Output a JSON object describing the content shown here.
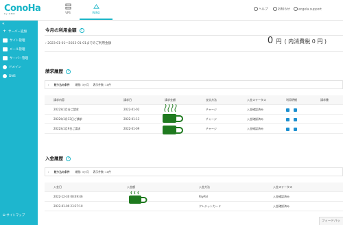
{
  "header": {
    "logo": "ConoHa",
    "logo_sub": "by GMO",
    "tabs": [
      {
        "label": "VPS"
      },
      {
        "label": "WING"
      }
    ],
    "help": "ヘルプ",
    "notice": "お知らせ",
    "account": "angela.support"
  },
  "sidebar": {
    "collapse": "«",
    "items": [
      {
        "label": "サーバー追加"
      },
      {
        "label": "サイト管理"
      },
      {
        "label": "メール管理"
      },
      {
        "label": "サーバー管理"
      },
      {
        "label": "ドメイン"
      },
      {
        "label": "DNS"
      }
    ],
    "sitemap": "サイトマップ"
  },
  "usage": {
    "title": "今月の利用金額",
    "period": "2023-01-01～2023-01-01までのご利用金額",
    "amount": "0",
    "unit": "円",
    "tax": "( 内消費税 0 円 )"
  },
  "billing": {
    "title": "請求履歴",
    "filter_label": "絞り込み条件",
    "filter_period": "期間: 3ヶ月",
    "filter_count": "表示件数: 10件",
    "columns": [
      "請求内容",
      "請求日",
      "請求金額",
      "支払方法",
      "入金ステータス",
      "利用明細",
      "請求書"
    ],
    "rows": [
      {
        "desc": "2022年1月分ご請求",
        "date": "2022-01-02",
        "method": "チャージ",
        "status": "入金確認済み"
      },
      {
        "desc": "2022年1月13日ご請求",
        "date": "2022-01-13",
        "method": "チャージ",
        "status": "入金確認済み"
      },
      {
        "desc": "2022年1月9日ご請求",
        "date": "2022-01-09",
        "method": "チャージ",
        "status": "入金確認済み"
      }
    ]
  },
  "payments": {
    "title": "入金履歴",
    "filter_label": "絞り込み条件",
    "filter_period": "期間: 3ヶ月",
    "filter_count": "表示件数: 10件",
    "columns": [
      "入金日",
      "入金額",
      "入金方法",
      "入金ステータス"
    ],
    "rows": [
      {
        "date": "2022-12-30 08:49:46",
        "method": "PayPal",
        "status": "入金確認済み"
      },
      {
        "date": "2022-01-09 23:27:10",
        "method": "クレジットカード",
        "status": "入金確認済み"
      }
    ]
  },
  "feedback": "フィードバック",
  "colors": {
    "accent": "#19b5c7",
    "sidebar": "#1eb6ce",
    "cup": "#1f7a1f"
  },
  "icons": {
    "amount_cell": "green-mug-icon",
    "statement": "document-icon"
  }
}
